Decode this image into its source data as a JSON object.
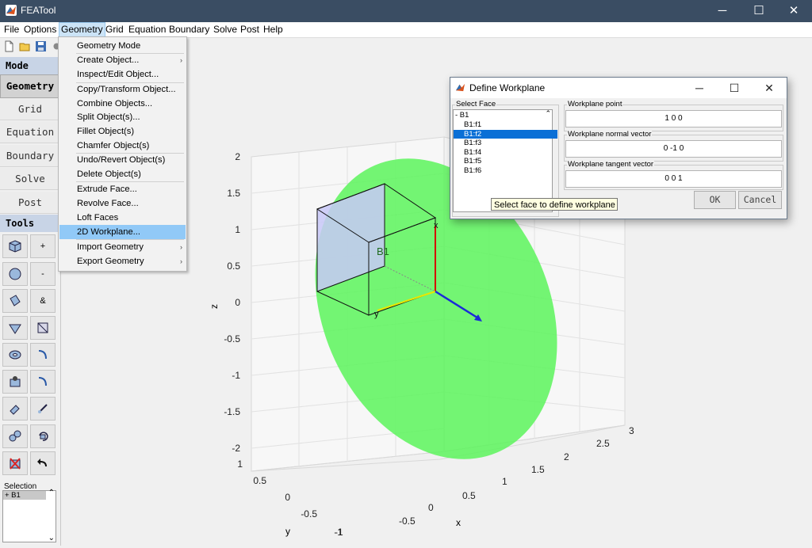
{
  "window": {
    "title": "FEATool",
    "minimize": "─",
    "maximize": "☐",
    "close": "✕"
  },
  "menubar": [
    "File",
    "Options",
    "Geometry",
    "Grid",
    "Equation",
    "Boundary",
    "Solve",
    "Post",
    "Help"
  ],
  "modes": {
    "mode_label": "Mode",
    "items": [
      "Geometry",
      "Grid",
      "Equation",
      "Boundary",
      "Solve",
      "Post"
    ],
    "tools_label": "Tools",
    "tool_plus": "+",
    "tool_minus": "-",
    "tool_and": "&"
  },
  "selection": {
    "label": "Selection",
    "items": [
      "+ B1"
    ],
    "scroll_up": "⌃",
    "scroll_down": "⌄"
  },
  "geometry_menu": [
    {
      "label": "Geometry Mode",
      "submenu": false
    },
    {
      "label": "Create Object...",
      "submenu": true
    },
    {
      "label": "Inspect/Edit Object...",
      "submenu": false
    },
    {
      "label": "Copy/Transform Object...",
      "submenu": false
    },
    {
      "label": "Combine Objects...",
      "submenu": false
    },
    {
      "label": "Split Object(s)...",
      "submenu": false
    },
    {
      "label": "Fillet Object(s)",
      "submenu": false
    },
    {
      "label": "Chamfer Object(s)",
      "submenu": false
    },
    {
      "label": "Undo/Revert Object(s)",
      "submenu": false
    },
    {
      "label": "Delete Object(s)",
      "submenu": false
    },
    {
      "label": "Extrude Face...",
      "submenu": false
    },
    {
      "label": "Revolve Face...",
      "submenu": false
    },
    {
      "label": "Loft Faces",
      "submenu": false
    },
    {
      "label": "2D Workplane...",
      "submenu": false,
      "highlighted": true
    },
    {
      "label": "Import Geometry",
      "submenu": true
    },
    {
      "label": "Export Geometry",
      "submenu": true
    }
  ],
  "plot": {
    "z_axis": {
      "label": "z",
      "ticks": [
        "2",
        "1.5",
        "1",
        "0.5",
        "0",
        "-0.5",
        "-1",
        "-1.5",
        "-2"
      ]
    },
    "x_axis": {
      "label": "x",
      "ticks": [
        "-1",
        "-0.5",
        "0",
        "0.5",
        "1",
        "1.5",
        "2",
        "2.5",
        "3"
      ]
    },
    "y_axis": {
      "label": "y",
      "ticks": [
        "1",
        "0.5",
        "0",
        "-0.5",
        "-1"
      ]
    },
    "object_label": "B1",
    "local_x_label": "x",
    "local_y_label": "y",
    "disk_color": "#5cf45c",
    "cube_face_color": "#c8c8f8"
  },
  "dialog": {
    "title": "Define Workplane",
    "select_face_label": "Select Face",
    "faces": [
      "- B1",
      "B1:f1",
      "B1:f2",
      "B1:f3",
      "B1:f4",
      "B1:f5",
      "B1:f6"
    ],
    "selected_face": "B1:f2",
    "workplane_point_label": "Workplane point",
    "workplane_point": "1 0 0",
    "normal_label": "Workplane normal vector",
    "normal": "0 -1 0",
    "tangent_label": "Workplane tangent vector",
    "tangent": "0 0 1",
    "ok": "OK",
    "cancel": "Cancel",
    "tooltip": "Select face to define workplane"
  }
}
